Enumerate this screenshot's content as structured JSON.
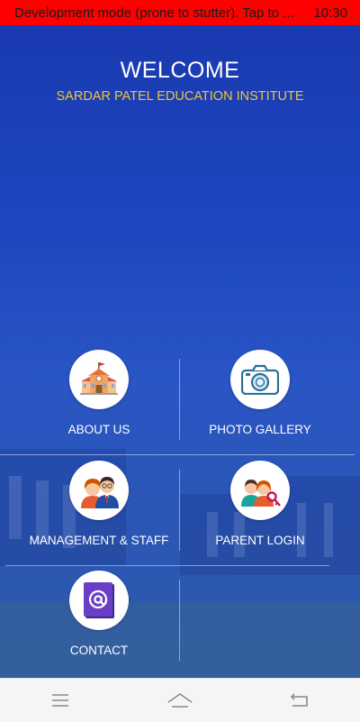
{
  "status_bar": {
    "message": "Development mode (prone to stutter). Tap to ...",
    "time": "10:30",
    "background": "#ff0000"
  },
  "header": {
    "title": "WELCOME",
    "subtitle": "SARDAR PATEL EDUCATION INSTITUTE",
    "subtitle_color": "#f4c430"
  },
  "menu": {
    "about_us": {
      "label": "ABOUT US",
      "icon": "school-building-icon"
    },
    "photo_gallery": {
      "label": "PHOTO GALLERY",
      "icon": "camera-icon"
    },
    "management_staff": {
      "label": "MANAGEMENT & STAFF",
      "icon": "staff-people-icon"
    },
    "parent_login": {
      "label": "PARENT LOGIN",
      "icon": "parent-key-icon"
    },
    "contact": {
      "label": "CONTACT",
      "icon": "at-sign-icon"
    }
  },
  "nav_bar": {
    "menu": "menu-icon",
    "home": "home-icon",
    "back": "back-icon"
  },
  "colors": {
    "background": "#1f3fb0",
    "nav_background": "#f5f5f5"
  }
}
